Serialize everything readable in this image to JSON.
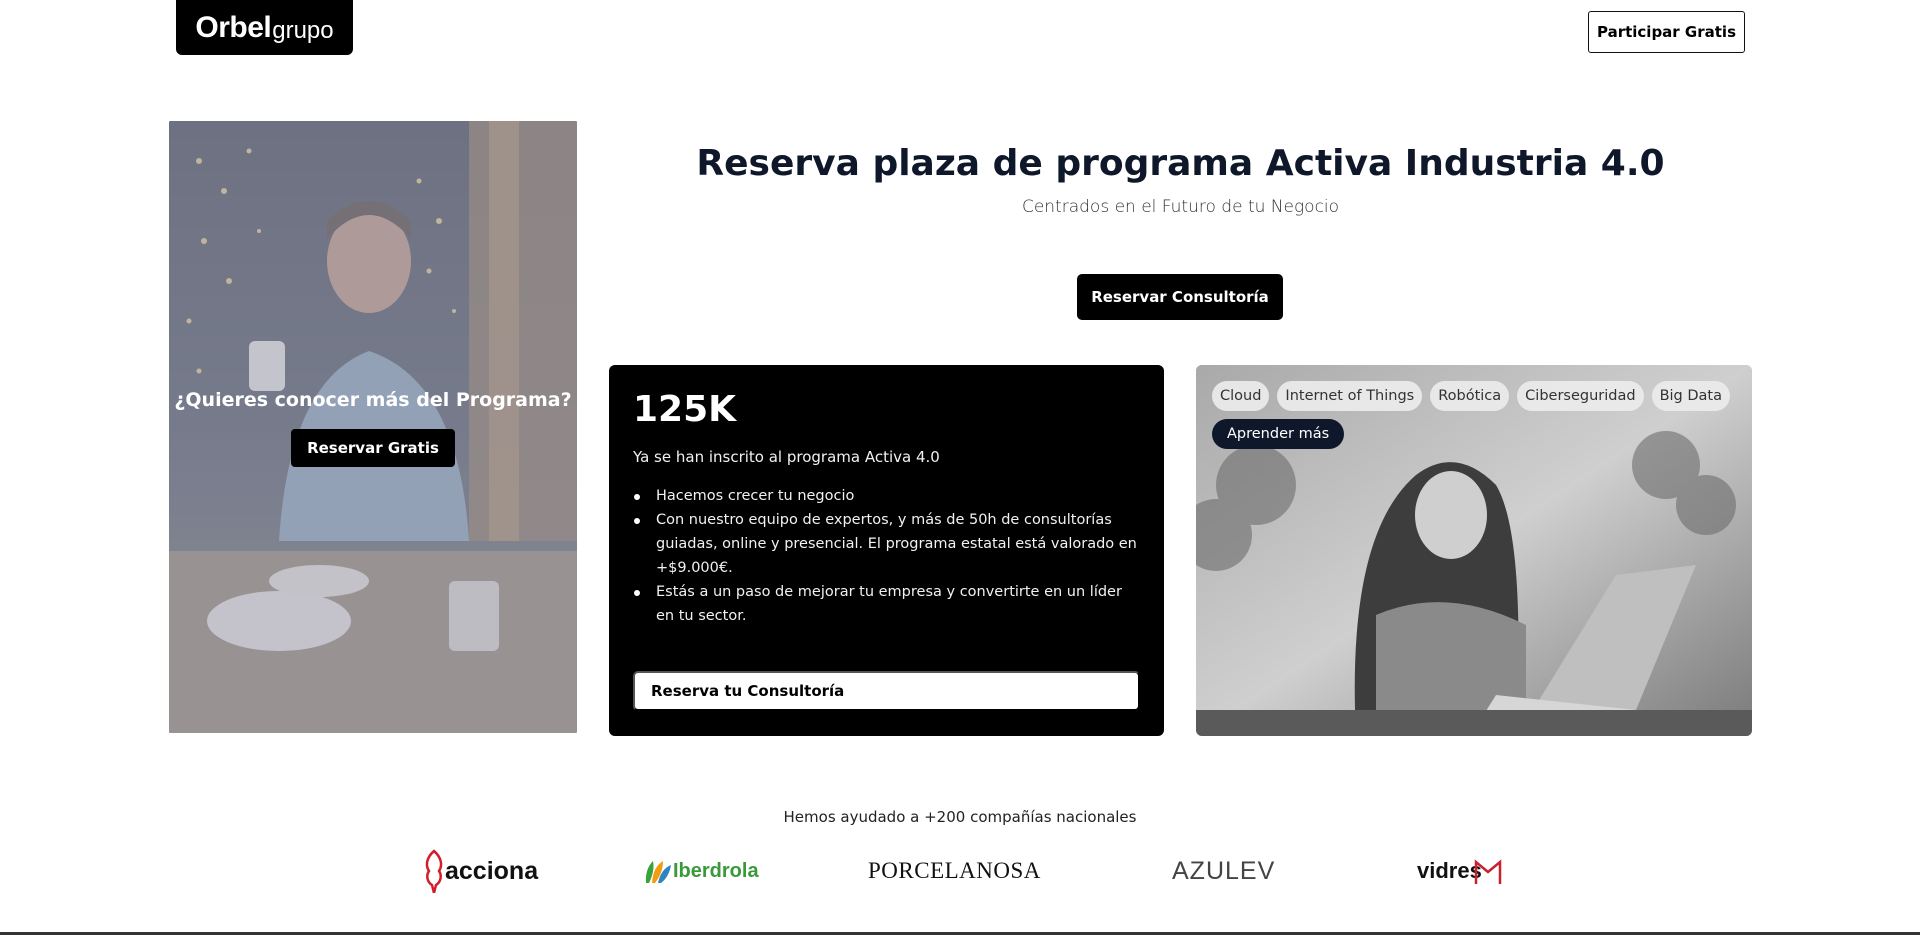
{
  "header": {
    "logo_main": "Orbel",
    "logo_sub": "grupo",
    "cta_label": "Participar Gratis"
  },
  "left_card": {
    "title": "¿Quieres conocer más del Programa?",
    "button_label": "Reservar Gratis"
  },
  "hero": {
    "title": "Reserva plaza de programa Activa Industria 4.0",
    "subtitle": "Centrados en el Futuro de tu Negocio",
    "button_label": "Reservar Consultoría"
  },
  "stats_card": {
    "big_number": "125K",
    "description": "Ya se han inscrito al programa Activa 4.0",
    "bullets": [
      "Hacemos crecer tu negocio",
      "Con nuestro equipo de expertos, y más de 50h de consultorías guiadas, online y presencial. El programa estatal está valorado en +$9.000€.",
      "Estás a un paso de mejorar tu empresa y convertirte en un líder en tu sector."
    ],
    "button_label": "Reserva tu Consultoría"
  },
  "topics_card": {
    "tags": [
      "Cloud",
      "Internet of Things",
      "Robótica",
      "Ciberseguridad",
      "Big Data"
    ],
    "learn_more": "Aprender más"
  },
  "clients": {
    "heading": "Hemos ayudado a +200 compañías nacionales",
    "logos": [
      "acciona",
      "Iberdrola",
      "PORCELANOSA",
      "AZULEV",
      "vidres"
    ]
  },
  "colors": {
    "dark_navy": "#0f172a",
    "black": "#000000",
    "iberdrola_green": "#3a9a3a",
    "acciona_red": "#d01f2b",
    "vidres_red": "#c8202e"
  }
}
